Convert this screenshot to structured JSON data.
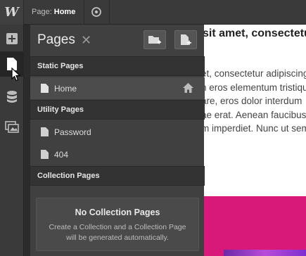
{
  "topbar": {
    "logo": "W",
    "page_label": "Page:",
    "page_value": "Home"
  },
  "canvas": {
    "heading": "sit amet, consectetur",
    "lines": [
      "et, consectetur adipiscing",
      "n eros elementum tristique.",
      "are, eros dolor interdum",
      "ae erat. Aenean faucibus",
      "m imperdiet. Nunc ut sem"
    ]
  },
  "panel": {
    "title": "Pages",
    "sections": {
      "static": "Static Pages",
      "utility": "Utility Pages",
      "collection": "Collection Pages"
    },
    "static_pages": [
      {
        "name": "Home",
        "home": true
      }
    ],
    "utility_pages": [
      {
        "name": "Password"
      },
      {
        "name": "404"
      }
    ],
    "empty": {
      "title": "No Collection Pages",
      "description": "Create a Collection and a Collection Page will be generated automatically."
    }
  },
  "colors": {
    "accent_magenta": "#d8197a",
    "panel_bg": "#404040"
  }
}
